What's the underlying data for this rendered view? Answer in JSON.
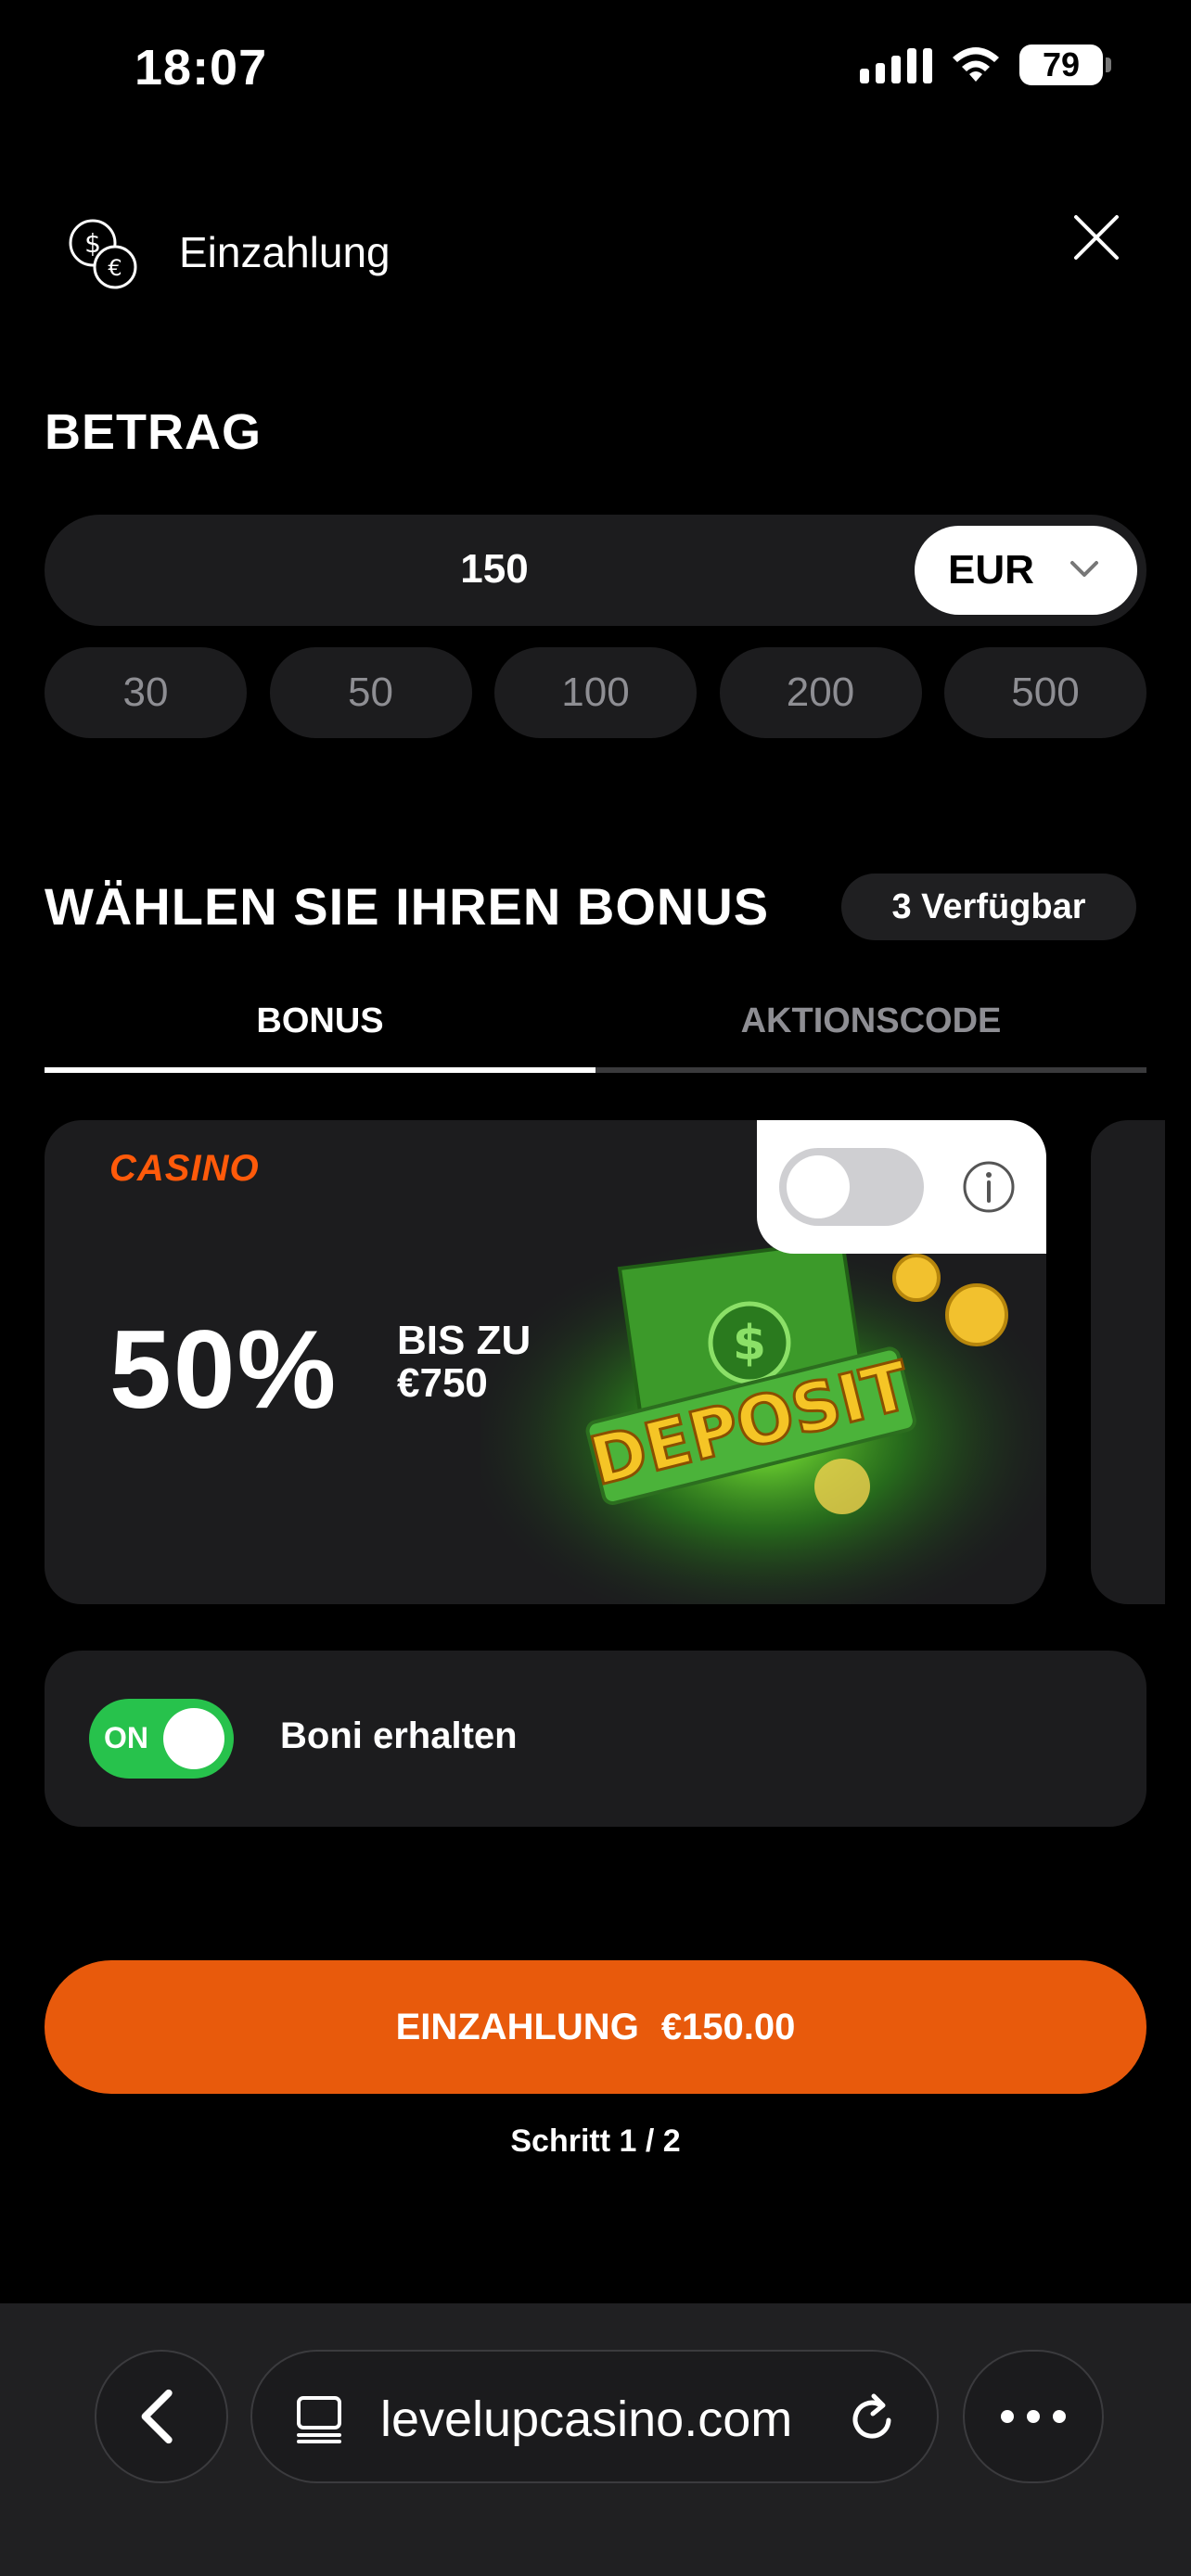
{
  "status_bar": {
    "time": "18:07",
    "battery": "79"
  },
  "header": {
    "title": "Einzahlung"
  },
  "amount": {
    "section_title": "BETRAG",
    "value": "150",
    "currency": "EUR",
    "presets": [
      "30",
      "50",
      "100",
      "200",
      "500"
    ]
  },
  "bonus": {
    "section_title": "WÄHLEN SIE IHREN BONUS",
    "available": "3 Verfügbar",
    "tabs": [
      "BONUS",
      "AKTIONSCODE"
    ],
    "active_tab": "BONUS",
    "card": {
      "brand": "CASINO",
      "percent": "50%",
      "upto_line1": "BIS ZU",
      "upto_line2": "€750",
      "art_text": "DEPOSIT",
      "selected": false
    },
    "receive_toggle_label": "ON",
    "receive_label": "Boni erhalten"
  },
  "actions": {
    "deposit_label": "EINZAHLUNG",
    "deposit_amount": "€150.00",
    "step": "Schritt 1 / 2"
  },
  "browser": {
    "url": "levelupcasino.com"
  },
  "colors": {
    "accent": "#e85a0c",
    "toggle_on": "#27c24c",
    "brand": "#ff5a0a"
  }
}
